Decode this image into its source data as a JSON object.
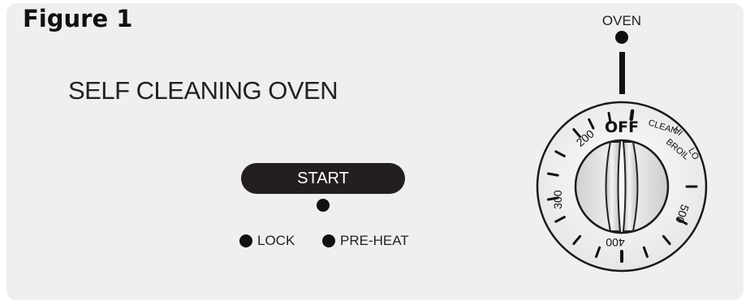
{
  "figure_title": "Figure 1",
  "oven_title": "SELF CLEANING OVEN",
  "start_button": "START",
  "indicators": {
    "lock": "LOCK",
    "preheat": "PRE-HEAT"
  },
  "knob": {
    "label": "OVEN",
    "off": "OFF",
    "clean": "CLEAN",
    "hi": "HI",
    "broil": "BROIL",
    "lo": "LO",
    "t200": "200",
    "t300": "300",
    "t400": "400",
    "t500": "500"
  }
}
